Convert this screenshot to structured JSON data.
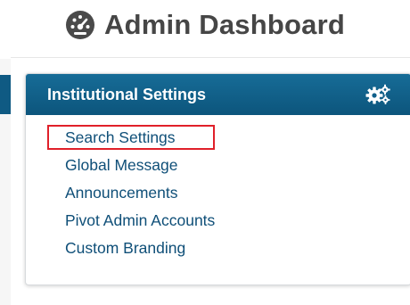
{
  "header": {
    "title": "Admin Dashboard",
    "icon": "dashboard-gauge-icon"
  },
  "panel": {
    "title": "Institutional Settings",
    "settings_icon": "cogs-icon",
    "header_color": "#0f5f8a",
    "links": [
      {
        "label": "Search Settings"
      },
      {
        "label": "Global Message"
      },
      {
        "label": "Announcements"
      },
      {
        "label": "Pivot Admin Accounts"
      },
      {
        "label": "Custom Branding"
      }
    ]
  },
  "highlight": {
    "target": "Search Settings",
    "color": "#e0202a"
  },
  "colors": {
    "link": "#0f4f78",
    "title_text": "#464646"
  }
}
